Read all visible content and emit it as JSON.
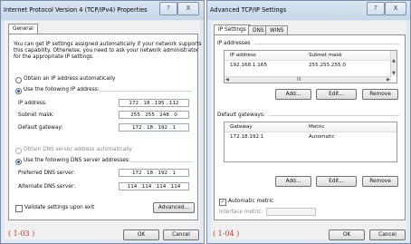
{
  "left": {
    "title": "Internet Protocol Version 4 (TCP/IPv4) Properties",
    "help": "?",
    "close": "X",
    "tab": "General",
    "intro": [
      "You can get IP settings assigned automatically if your network supports",
      "this capability. Otherwise, you need to ask your network administrator",
      "for the appropriate IP settings."
    ],
    "radio_auto_ip": "Obtain an IP address automatically",
    "radio_manual_ip": "Use the following IP address:",
    "ip_label": "IP address:",
    "ip_value": "172 . 18 . 195 . 112",
    "mask_label": "Subnet mask:",
    "mask_value": "255 . 255 . 248 . 0",
    "gw_label": "Default gateway:",
    "gw_value": "172 . 18 . 192 . 1",
    "radio_auto_dns": "Obtain DNS server address automatically",
    "radio_manual_dns": "Use the following DNS server addresses:",
    "pref_dns_label": "Preferred DNS server:",
    "pref_dns_value": "172 . 18 . 192 . 1",
    "alt_dns_label": "Alternate DNS server:",
    "alt_dns_value": "114 . 114 . 114 . 114",
    "validate": "Validate settings upon exit",
    "advanced": "Advanced...",
    "ok": "OK",
    "cancel": "Cancel",
    "caption": "( 1-03 )"
  },
  "right": {
    "title": "Advanced TCP/IP Settings",
    "help": "?",
    "close": "X",
    "tabs": [
      "IP Settings",
      "DNS",
      "WINS"
    ],
    "ip_group": "IP addresses",
    "ip_col1": "IP address",
    "ip_col2": "Subnet mask",
    "ip_row_addr": "192.168.1.165",
    "ip_row_mask": "255.255.255.0",
    "scroll_mid": "III",
    "add1": "Add...",
    "edit1": "Edit...",
    "remove1": "Remove",
    "gw_group": "Default gateways:",
    "gw_col1": "Gateway",
    "gw_col2": "Metric",
    "gw_row_addr": "172.18.192.1",
    "gw_row_metric": "Automatic",
    "add2": "Add...",
    "edit2": "Edit...",
    "remove2": "Remove",
    "auto_metric": "Automatic metric",
    "if_metric": "Interface metric:",
    "ok": "OK",
    "cancel": "Cancel",
    "caption": "( 1-04 )"
  }
}
